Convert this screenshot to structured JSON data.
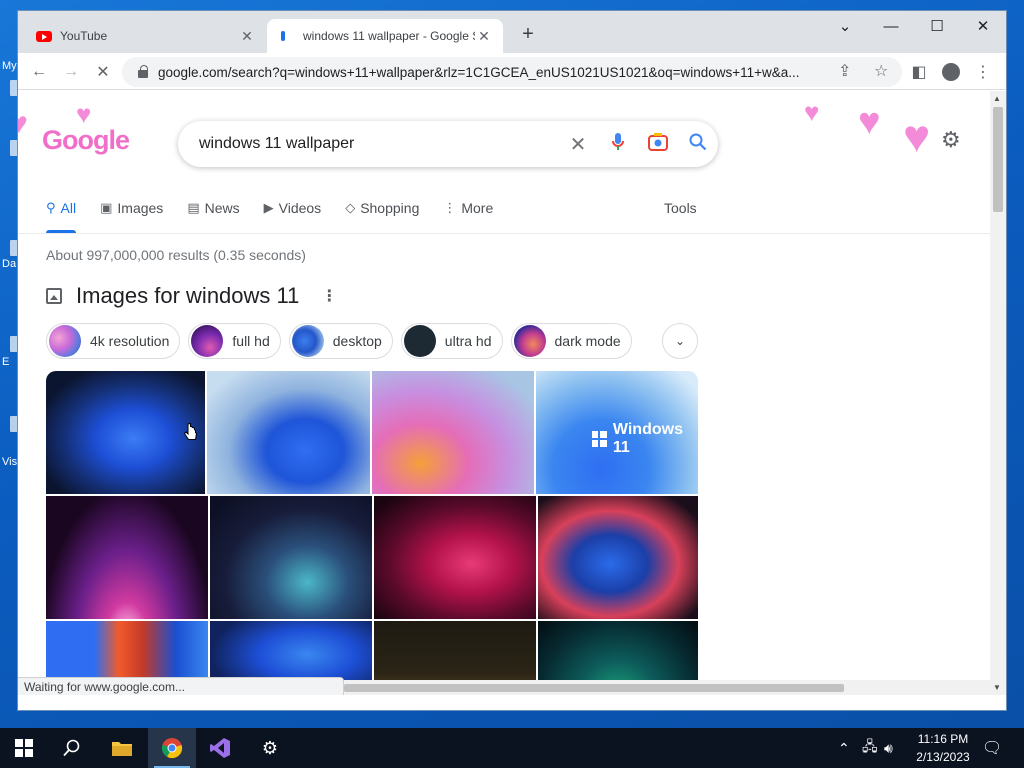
{
  "desktop": {
    "icon_labels": [
      "My",
      "Da",
      "E",
      "Vis"
    ]
  },
  "browser": {
    "tabs": [
      {
        "title": "YouTube",
        "favicon": "youtube-icon",
        "active": false
      },
      {
        "title": "windows 11 wallpaper - Google S",
        "favicon": "loading-icon",
        "active": true
      }
    ],
    "url": "google.com/search?q=windows+11+wallpaper&rlz=1C1GCEA_enUS1021US1021&oq=windows+11+w&a...",
    "status_text": "Waiting for www.google.com..."
  },
  "google": {
    "logo_text": "Google",
    "search_query": "windows 11 wallpaper",
    "nav_tabs": [
      {
        "label": "All",
        "icon": "search-icon",
        "active": true
      },
      {
        "label": "Images",
        "icon": "image-icon",
        "active": false
      },
      {
        "label": "News",
        "icon": "news-icon",
        "active": false
      },
      {
        "label": "Videos",
        "icon": "play-icon",
        "active": false
      },
      {
        "label": "Shopping",
        "icon": "tag-icon",
        "active": false
      },
      {
        "label": "More",
        "icon": "more-vert-icon",
        "active": false
      }
    ],
    "tools_label": "Tools",
    "result_stats": "About 997,000,000 results (0.35 seconds)",
    "images_heading": "Images for windows 11",
    "chips": [
      {
        "label": "4k resolution"
      },
      {
        "label": "full hd"
      },
      {
        "label": "desktop"
      },
      {
        "label": "ultra hd"
      },
      {
        "label": "dark mode"
      }
    ],
    "thumbnail_overlay_text": "Windows 11"
  },
  "taskbar": {
    "apps": [
      "windows-start-icon",
      "search-icon",
      "file-explorer-icon",
      "chrome-icon",
      "visual-studio-icon",
      "settings-icon"
    ],
    "time": "11:16 PM",
    "date": "2/13/2023"
  }
}
